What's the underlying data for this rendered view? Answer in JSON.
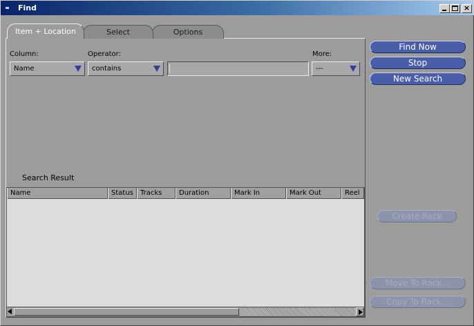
{
  "window": {
    "title": "Find",
    "controls": {
      "minimize": "minimize",
      "maximize": "maximize",
      "close": "×"
    }
  },
  "tabs": [
    {
      "label": "Item + Location",
      "active": true
    },
    {
      "label": "Select",
      "active": false
    },
    {
      "label": "Options",
      "active": false
    }
  ],
  "criteria": {
    "column_label": "Column:",
    "column_value": "Name",
    "operator_label": "Operator:",
    "operator_value": "contains",
    "search_value": "",
    "more_label": "More:",
    "more_value": "---"
  },
  "results": {
    "label": "Search Result",
    "columns": [
      "Name",
      "Status",
      "Tracks",
      "Duration",
      "Mark In",
      "Mark Out",
      "Reel"
    ],
    "rows": []
  },
  "actions": {
    "find_now": "Find Now",
    "stop": "Stop",
    "new_search": "New Search",
    "create_rack": "Create Rack",
    "move_to_rack": "Move To Rack...",
    "copy_to_rack": "Copy To Rack..."
  },
  "colors": {
    "window_bg": "#9c9c9c",
    "title_bar": "#0a246a",
    "button_active": "#4a5da8",
    "button_disabled": "#8c94ac",
    "table_bg": "#dcdcdc",
    "dropdown_arrow": "#2f3f9a"
  },
  "icons": {
    "app": "app-icon",
    "dropdown": "triangle-down-icon",
    "scroll_left": "arrow-left-icon",
    "scroll_right": "arrow-right-icon"
  }
}
